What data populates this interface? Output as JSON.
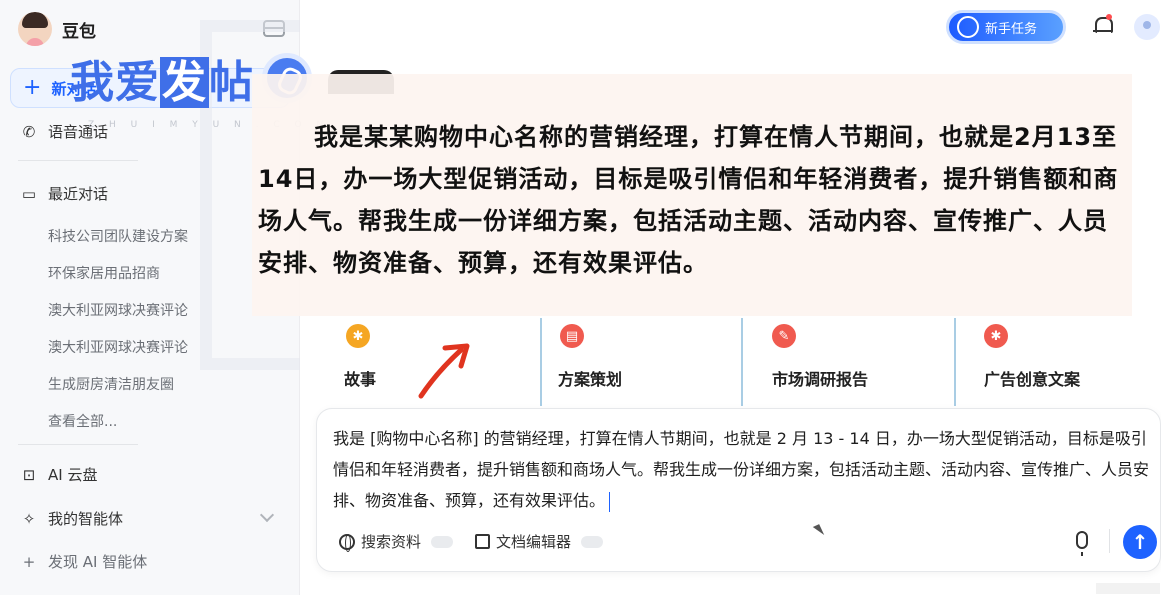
{
  "sidebar": {
    "brand": "豆包",
    "new_chat": "新对话",
    "voice_call": "语音通话",
    "recent_title": "最近对话",
    "history": [
      "科技公司团队建设方案",
      "环保家居用品招商",
      "澳大利亚网球决赛评论",
      "澳大利亚网球决赛评论",
      "生成厨房清洁朋友圈"
    ],
    "view_all": "查看全部...",
    "cloud": "AI 云盘",
    "agents": "我的智能体",
    "discover": "发现 AI 智能体"
  },
  "watermark": {
    "text_a": "我爱",
    "text_hl": "发",
    "text_b": "帖",
    "url": "Z H U I M Y U N . C O M"
  },
  "header": {
    "task_label": "新手任务"
  },
  "overlay": {
    "caption": "我是某某购物中心名称的营销经理，打算在情人节期间，也就是2月13至14日，办一场大型促销活动，目标是吸引情侣和年轻消费者，提升销售额和商场人气。帮我生成一份详细方案，包括活动主题、活动内容、宣传推广、人员安排、物资准备、预算，还有效果评估。"
  },
  "cards": [
    {
      "label": "故事",
      "icon": "lightbulb-icon",
      "color": "#f5a623"
    },
    {
      "label": "方案策划",
      "icon": "document-icon",
      "color": "#f05a4f"
    },
    {
      "label": "市场调研报告",
      "icon": "clipboard-icon",
      "color": "#f05a4f"
    },
    {
      "label": "广告创意文案",
      "icon": "lightbulb-icon",
      "color": "#f05a4f"
    }
  ],
  "input": {
    "text": "我是 [购物中心名称] 的营销经理，打算在情人节期间，也就是 2 月 13 - 14 日，办一场大型促销活动，目标是吸引情侣和年轻消费者，提升销售额和商场人气。帮我生成一份详细方案，包括活动主题、活动内容、宣传推广、人员安排、物资准备、预算，还有效果评估。",
    "tool_search": "搜索资料",
    "tool_editor": "文档编辑器"
  },
  "colors": {
    "accent": "#1e62ff",
    "overlay_bg": "#fdf4f0"
  }
}
